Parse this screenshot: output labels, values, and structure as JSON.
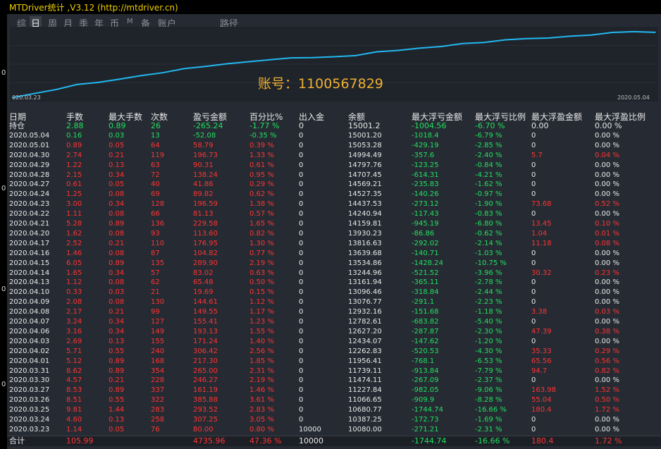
{
  "window": {
    "title": "MTDriver统计 ,V3.12 (http://mtdriver.cn)"
  },
  "toolbar": {
    "items": [
      "综",
      "日",
      "周",
      "月",
      "季",
      "年",
      "币",
      "M",
      "备",
      "账户",
      "路径"
    ],
    "active": "日"
  },
  "chart_data": {
    "type": "line",
    "x_start_label": "020.03.23",
    "x_end_label": "2020.05.04",
    "account_label": "账号：1100567829",
    "x": [
      "2020.03.23",
      "2020.03.24",
      "2020.03.25",
      "2020.03.26",
      "2020.03.27",
      "2020.03.30",
      "2020.03.31",
      "2020.04.01",
      "2020.04.02",
      "2020.04.03",
      "2020.04.06",
      "2020.04.07",
      "2020.04.08",
      "2020.04.09",
      "2020.04.10",
      "2020.04.13",
      "2020.04.14",
      "2020.04.15",
      "2020.04.16",
      "2020.04.17",
      "2020.04.20",
      "2020.04.21",
      "2020.04.22",
      "2020.04.23",
      "2020.04.24",
      "2020.04.27",
      "2020.04.28",
      "2020.04.29",
      "2020.04.30",
      "2020.05.01",
      "2020.05.04"
    ],
    "values": [
      10080.0,
      10387.25,
      10680.77,
      11066.65,
      11227.84,
      11474.11,
      11739.11,
      11956.41,
      12262.83,
      12434.07,
      12627.2,
      12782.61,
      12932.16,
      13076.77,
      13096.46,
      13161.94,
      13244.96,
      13534.86,
      13639.68,
      13816.63,
      13930.23,
      14159.81,
      14240.94,
      14437.53,
      14527.35,
      14569.21,
      14707.45,
      14797.76,
      14994.49,
      15053.28,
      15001.2
    ],
    "color": "#22b8f0"
  },
  "table": {
    "headers": [
      "日期",
      "手数",
      "最大手数",
      "次数",
      "盈亏金额",
      "百分比%",
      "出入金",
      "余额",
      "最大浮亏金额",
      "最大浮亏比例",
      "最大浮盈金额",
      "最大浮盈比例"
    ],
    "holding": [
      "持仓",
      "2.88",
      "0.89",
      "26",
      "-265.24",
      "-1.77 %",
      "0",
      "15001.2",
      "-1004.56",
      "-6.70 %",
      "0.00",
      "0.00 %"
    ],
    "rows": [
      [
        "2020.05.04",
        "0.16",
        "0.03",
        "13",
        "-52.08",
        "-0.35 %",
        "0",
        "15001.20",
        "-1018.4",
        "-6.79 %",
        "0",
        "0.00 %"
      ],
      [
        "2020.05.01",
        "0.89",
        "0.05",
        "64",
        "58.79",
        "0.39 %",
        "0",
        "15053.28",
        "-429.19",
        "-2.85 %",
        "0",
        "0.00 %"
      ],
      [
        "2020.04.30",
        "2.74",
        "0.21",
        "119",
        "196.73",
        "1.33 %",
        "0",
        "14994.49",
        "-357.6",
        "-2.40 %",
        "5.7",
        "0.04 %"
      ],
      [
        "2020.04.29",
        "1.22",
        "0.13",
        "63",
        "90.31",
        "0.61 %",
        "0",
        "14797.76",
        "-123.25",
        "-0.84 %",
        "0",
        "0.00 %"
      ],
      [
        "2020.04.28",
        "2.15",
        "0.34",
        "72",
        "138.24",
        "0.95 %",
        "0",
        "14707.45",
        "-614.31",
        "-4.21 %",
        "0",
        "0.00 %"
      ],
      [
        "2020.04.27",
        "0.61",
        "0.05",
        "40",
        "41.86",
        "0.29 %",
        "0",
        "14569.21",
        "-235.83",
        "-1.62 %",
        "0",
        "0.00 %"
      ],
      [
        "2020.04.24",
        "1.25",
        "0.08",
        "69",
        "89.82",
        "0.62 %",
        "0",
        "14527.35",
        "-140.26",
        "-0.97 %",
        "0",
        "0.00 %"
      ],
      [
        "2020.04.23",
        "3.00",
        "0.34",
        "128",
        "196.59",
        "1.38 %",
        "0",
        "14437.53",
        "-273.12",
        "-1.90 %",
        "73.68",
        "0.52 %"
      ],
      [
        "2020.04.22",
        "1.11",
        "0.08",
        "66",
        "81.13",
        "0.57 %",
        "0",
        "14240.94",
        "-117.43",
        "-0.83 %",
        "0",
        "0.00 %"
      ],
      [
        "2020.04.21",
        "5.28",
        "0.89",
        "136",
        "229.58",
        "1.65 %",
        "0",
        "14159.81",
        "-945.19",
        "-6.80 %",
        "13.45",
        "0.10 %"
      ],
      [
        "2020.04.20",
        "1.62",
        "0.08",
        "93",
        "113.60",
        "0.82 %",
        "0",
        "13930.23",
        "-86.86",
        "-0.62 %",
        "1.04",
        "0.01 %"
      ],
      [
        "2020.04.17",
        "2.52",
        "0.21",
        "110",
        "176.95",
        "1.30 %",
        "0",
        "13816.63",
        "-292.02",
        "-2.14 %",
        "11.18",
        "0.08 %"
      ],
      [
        "2020.04.16",
        "1.46",
        "0.08",
        "87",
        "104.82",
        "0.77 %",
        "0",
        "13639.68",
        "-140.71",
        "-1.03 %",
        "0",
        "0.00 %"
      ],
      [
        "2020.04.15",
        "6.05",
        "0.89",
        "135",
        "289.90",
        "2.19 %",
        "0",
        "13534.86",
        "-1428.24",
        "-10.75 %",
        "0",
        "0.00 %"
      ],
      [
        "2020.04.14",
        "1.65",
        "0.34",
        "57",
        "83.02",
        "0.63 %",
        "0",
        "13244.96",
        "-521.52",
        "-3.96 %",
        "30.32",
        "0.23 %"
      ],
      [
        "2020.04.13",
        "1.12",
        "0.08",
        "62",
        "65.48",
        "0.50 %",
        "0",
        "13161.94",
        "-365.11",
        "-2.78 %",
        "0",
        "0.00 %"
      ],
      [
        "2020.04.10",
        "0.33",
        "0.03",
        "21",
        "19.69",
        "0.15 %",
        "0",
        "13096.46",
        "-318.84",
        "-2.44 %",
        "0",
        "0.00 %"
      ],
      [
        "2020.04.09",
        "2.08",
        "0.08",
        "130",
        "144.61",
        "1.12 %",
        "0",
        "13076.77",
        "-291.1",
        "-2.23 %",
        "0",
        "0.00 %"
      ],
      [
        "2020.04.08",
        "2.17",
        "0.21",
        "99",
        "149.55",
        "1.17 %",
        "0",
        "12932.16",
        "-151.68",
        "-1.18 %",
        "3.38",
        "0.03 %"
      ],
      [
        "2020.04.07",
        "3.24",
        "0.34",
        "127",
        "155.41",
        "1.23 %",
        "0",
        "12782.61",
        "-683.82",
        "-5.40 %",
        "0",
        "0.00 %"
      ],
      [
        "2020.04.06",
        "3.16",
        "0.34",
        "149",
        "193.13",
        "1.55 %",
        "0",
        "12627.20",
        "-287.87",
        "-2.30 %",
        "47.39",
        "0.38 %"
      ],
      [
        "2020.04.03",
        "2.69",
        "0.13",
        "155",
        "171.24",
        "1.40 %",
        "0",
        "12434.07",
        "-147.62",
        "-1.20 %",
        "0",
        "0.00 %"
      ],
      [
        "2020.04.02",
        "5.71",
        "0.55",
        "240",
        "306.42",
        "2.56 %",
        "0",
        "12262.83",
        "-520.53",
        "-4.30 %",
        "35.33",
        "0.29 %"
      ],
      [
        "2020.04.01",
        "5.12",
        "0.89",
        "168",
        "217.30",
        "1.85 %",
        "0",
        "11956.41",
        "-768.1",
        "-6.53 %",
        "65.56",
        "0.56 %"
      ],
      [
        "2020.03.31",
        "8.62",
        "0.89",
        "354",
        "265.00",
        "2.31 %",
        "0",
        "11739.11",
        "-913.84",
        "-7.79 %",
        "94.7",
        "0.82 %"
      ],
      [
        "2020.03.30",
        "4.57",
        "0.21",
        "228",
        "246.27",
        "2.19 %",
        "0",
        "11474.11",
        "-267.09",
        "-2.37 %",
        "0",
        "0.00 %"
      ],
      [
        "2020.03.27",
        "8.53",
        "0.89",
        "337",
        "161.19",
        "1.46 %",
        "0",
        "11227.84",
        "-982.05",
        "-9.06 %",
        "163.98",
        "1.52 %"
      ],
      [
        "2020.03.26",
        "8.51",
        "0.55",
        "322",
        "385.88",
        "3.61 %",
        "0",
        "11066.65",
        "-909.9",
        "-8.28 %",
        "55.04",
        "0.50 %"
      ],
      [
        "2020.03.25",
        "9.81",
        "1.44",
        "283",
        "293.52",
        "2.83 %",
        "0",
        "10680.77",
        "-1744.74",
        "-16.66 %",
        "180.4",
        "1.72 %"
      ],
      [
        "2020.03.24",
        "4.60",
        "0.13",
        "258",
        "307.25",
        "3.05 %",
        "0",
        "10387.25",
        "-172.73",
        "-1.69 %",
        "0",
        "0.00 %"
      ],
      [
        "2020.03.23",
        "1.14",
        "0.05",
        "76",
        "80.00",
        "0.80 %",
        "10000",
        "10080.00",
        "-271.21",
        "-2.31 %",
        "0",
        "0.00 %"
      ]
    ],
    "total": [
      "合计",
      "105.99",
      "",
      "",
      "4735.96",
      "47.36 %",
      "10000",
      "",
      "-1744.74",
      "-16.66 %",
      "180.4",
      "1.72 %"
    ]
  },
  "left_axis": {
    "ticks": [
      "0",
      "0",
      "0",
      "0"
    ]
  },
  "colors": {
    "positive": "#ff3333",
    "negative": "#22e060",
    "neutral": "#e8e8e8",
    "title": "#f0d000",
    "account": "#f0b030",
    "line": "#22b8f0"
  }
}
